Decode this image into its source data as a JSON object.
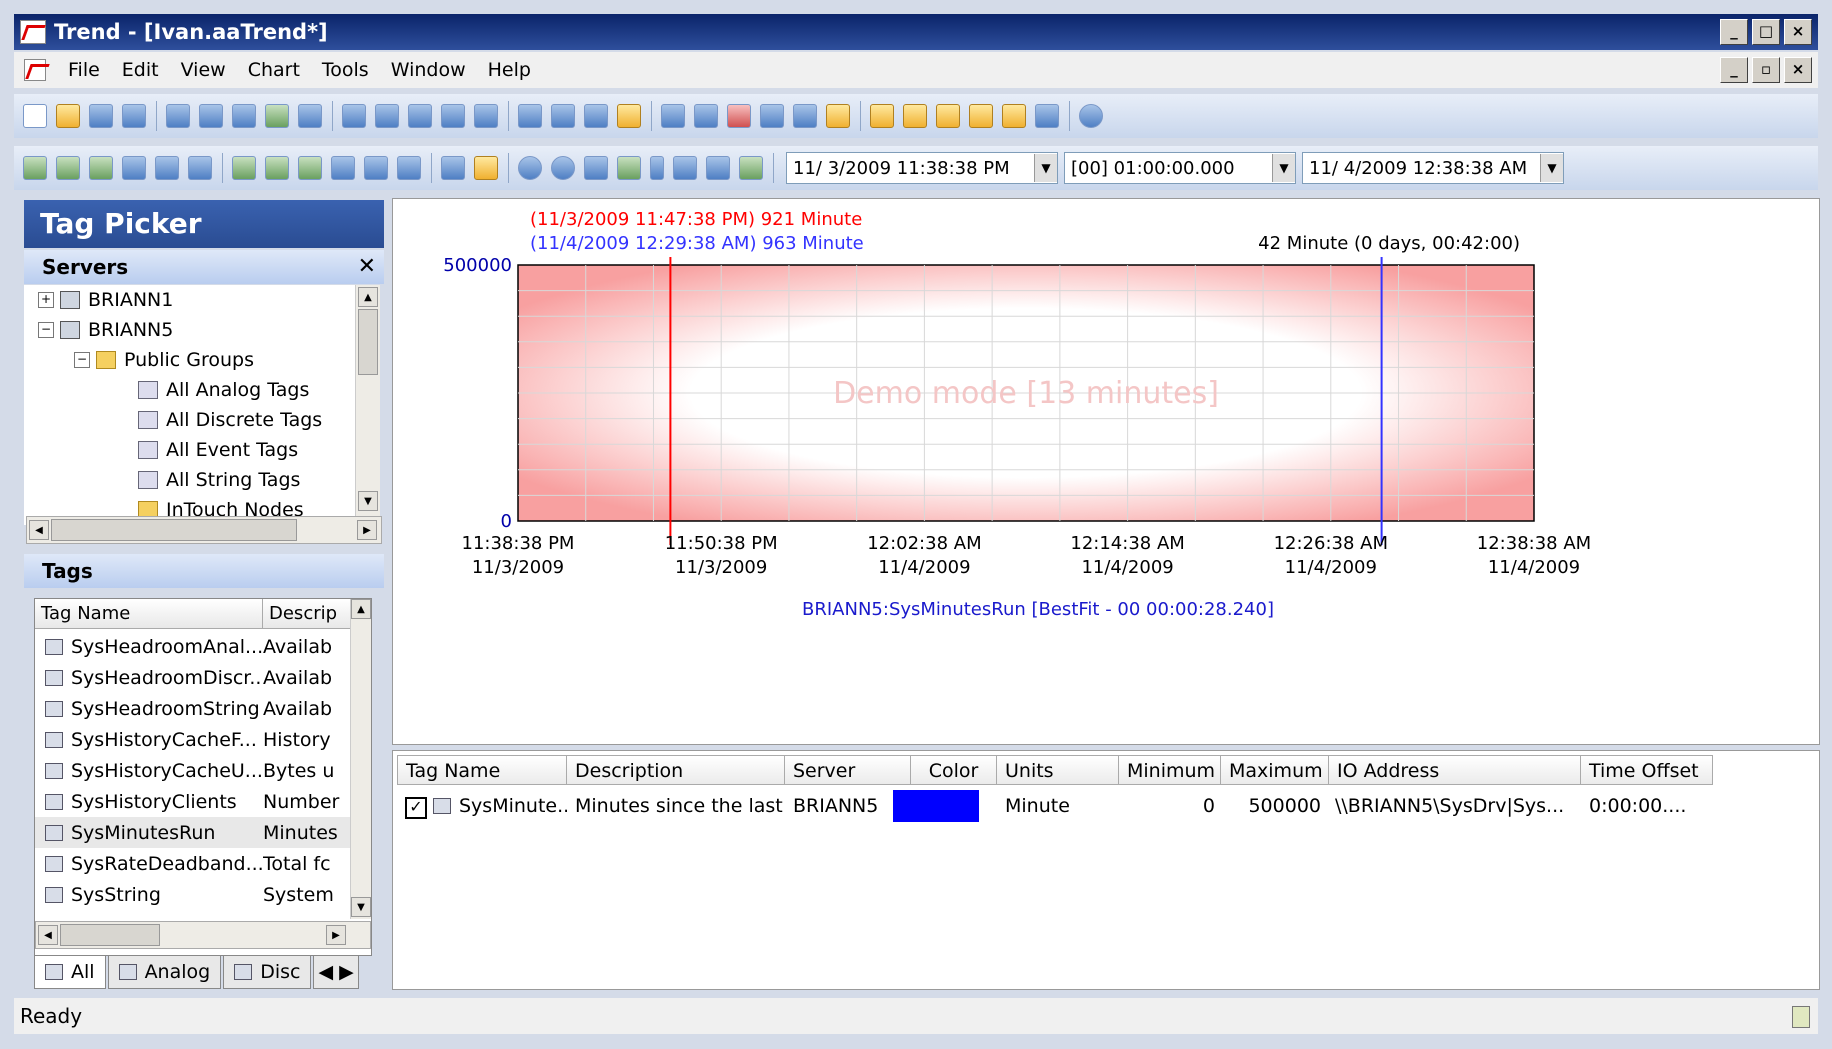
{
  "window": {
    "title": "Trend - [Ivan.aaTrend*]"
  },
  "menu": [
    "File",
    "Edit",
    "View",
    "Chart",
    "Tools",
    "Window",
    "Help"
  ],
  "toolbar": {
    "start_time": "11/ 3/2009 11:38:38 PM",
    "duration": "[00] 01:00:00.000",
    "end_time": "11/ 4/2009 12:38:38 AM"
  },
  "tag_picker": {
    "title": "Tag Picker",
    "servers_label": "Servers",
    "tree": [
      {
        "label": "BRIANN1",
        "level": 0,
        "expander": "+"
      },
      {
        "label": "BRIANN5",
        "level": 0,
        "expander": "-"
      },
      {
        "label": "Public Groups",
        "level": 1,
        "expander": "-"
      },
      {
        "label": "All Analog Tags",
        "level": 2
      },
      {
        "label": "All Discrete Tags",
        "level": 2
      },
      {
        "label": "All Event Tags",
        "level": 2
      },
      {
        "label": "All String Tags",
        "level": 2
      },
      {
        "label": "InTouch Nodes",
        "level": 2
      }
    ],
    "tags_label": "Tags",
    "tag_columns": [
      "Tag Name",
      "Descrip"
    ],
    "tags": [
      {
        "name": "SysHeadroomAnal...",
        "desc": "Availab"
      },
      {
        "name": "SysHeadroomDiscr...",
        "desc": "Availab"
      },
      {
        "name": "SysHeadroomString",
        "desc": "Availab"
      },
      {
        "name": "SysHistoryCacheF...",
        "desc": "History"
      },
      {
        "name": "SysHistoryCacheU...",
        "desc": "Bytes u"
      },
      {
        "name": "SysHistoryClients",
        "desc": "Number"
      },
      {
        "name": "SysMinutesRun",
        "desc": "Minutes",
        "selected": true
      },
      {
        "name": "SysRateDeadband...",
        "desc": "Total fc"
      },
      {
        "name": "SysString",
        "desc": "System"
      }
    ],
    "tabs": [
      "All",
      "Analog",
      "Disc"
    ]
  },
  "chart_data": {
    "type": "line",
    "title": "",
    "ylim": [
      0,
      500000
    ],
    "y_ticks": [
      "500000",
      "0"
    ],
    "x_ticks": [
      {
        "time": "11:38:38 PM",
        "date": "11/3/2009"
      },
      {
        "time": "11:50:38 PM",
        "date": "11/3/2009"
      },
      {
        "time": "12:02:38 AM",
        "date": "11/4/2009"
      },
      {
        "time": "12:14:38 AM",
        "date": "11/4/2009"
      },
      {
        "time": "12:26:38 AM",
        "date": "11/4/2009"
      },
      {
        "time": "12:38:38 AM",
        "date": "11/4/2009"
      }
    ],
    "cursor1_label": "(11/3/2009 11:47:38 PM) 921 Minute",
    "cursor2_label": "(11/4/2009 12:29:38 AM) 963 Minute",
    "delta_label": "42 Minute (0 days, 00:42:00)",
    "watermark": "Demo mode [13 minutes]",
    "series_label": "BRIANN5:SysMinutesRun [BestFit - 00 00:00:28.240]",
    "cursor1_color": "#ff0000",
    "cursor2_color": "#3333ff",
    "background_tint": "#f8a0a0"
  },
  "grid": {
    "columns": [
      "Tag Name",
      "Description",
      "Server",
      "Color",
      "Units",
      "Minimum",
      "Maximum",
      "IO Address",
      "Time Offset"
    ],
    "row": {
      "tag": "SysMinute...",
      "description": "Minutes since the last s...",
      "server": "BRIANN5",
      "color": "#0000ff",
      "units": "Minute",
      "minimum": "0",
      "maximum": "500000",
      "io": "\\\\BRIANN5\\SysDrv|Sys...",
      "offset": "0:00:00...."
    }
  },
  "status": {
    "text": "Ready"
  }
}
